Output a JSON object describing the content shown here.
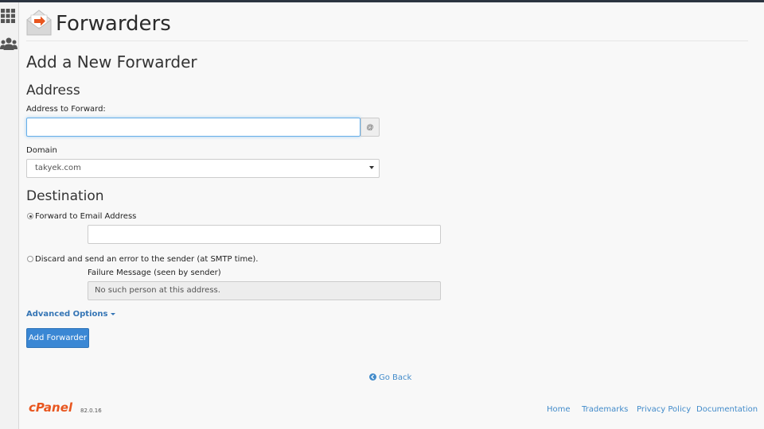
{
  "header": {
    "title": "Forwarders"
  },
  "form": {
    "heading": "Add a New Forwarder",
    "address_section": "Address",
    "address_label": "Address to Forward:",
    "address_value": "",
    "at_symbol": "@",
    "domain_label": "Domain",
    "domain_selected": "takyek.com",
    "destination_section": "Destination",
    "forward_option": "Forward to Email Address",
    "forward_value": "",
    "discard_option": "Discard and send an error to the sender (at SMTP time).",
    "failure_label": "Failure Message (seen by sender)",
    "failure_placeholder": "No such person at this address.",
    "advanced_options": "Advanced Options",
    "submit_label": "Add Forwarder",
    "selected_destination": "forward"
  },
  "go_back": "Go Back",
  "footer": {
    "brand": "cPanel",
    "version": "82.0.16",
    "links": [
      "Home",
      "Trademarks",
      "Privacy Policy",
      "Documentation"
    ]
  },
  "icons": {
    "sidebar": [
      "apps-grid-icon",
      "users-icon"
    ],
    "header": "forwarders-envelope-icon",
    "go_back": "arrow-circle-left-icon"
  },
  "colors": {
    "accent": "#428bca",
    "button": "#3a87d4",
    "brand_orange": "#e8561f"
  }
}
